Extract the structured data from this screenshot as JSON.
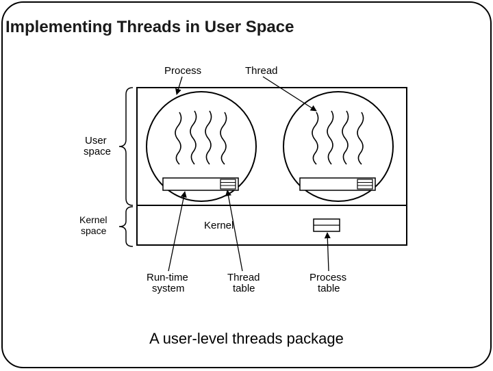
{
  "title": "Implementing Threads in User Space",
  "caption": "A user-level threads package",
  "labels": {
    "process": "Process",
    "thread": "Thread",
    "user_space1": "User",
    "user_space2": "space",
    "kernel_space1": "Kernel",
    "kernel_space2": "space",
    "kernel": "Kernel",
    "runtime1": "Run-time",
    "runtime2": "system",
    "thread_table1": "Thread",
    "thread_table2": "table",
    "process_table1": "Process",
    "process_table2": "table"
  }
}
